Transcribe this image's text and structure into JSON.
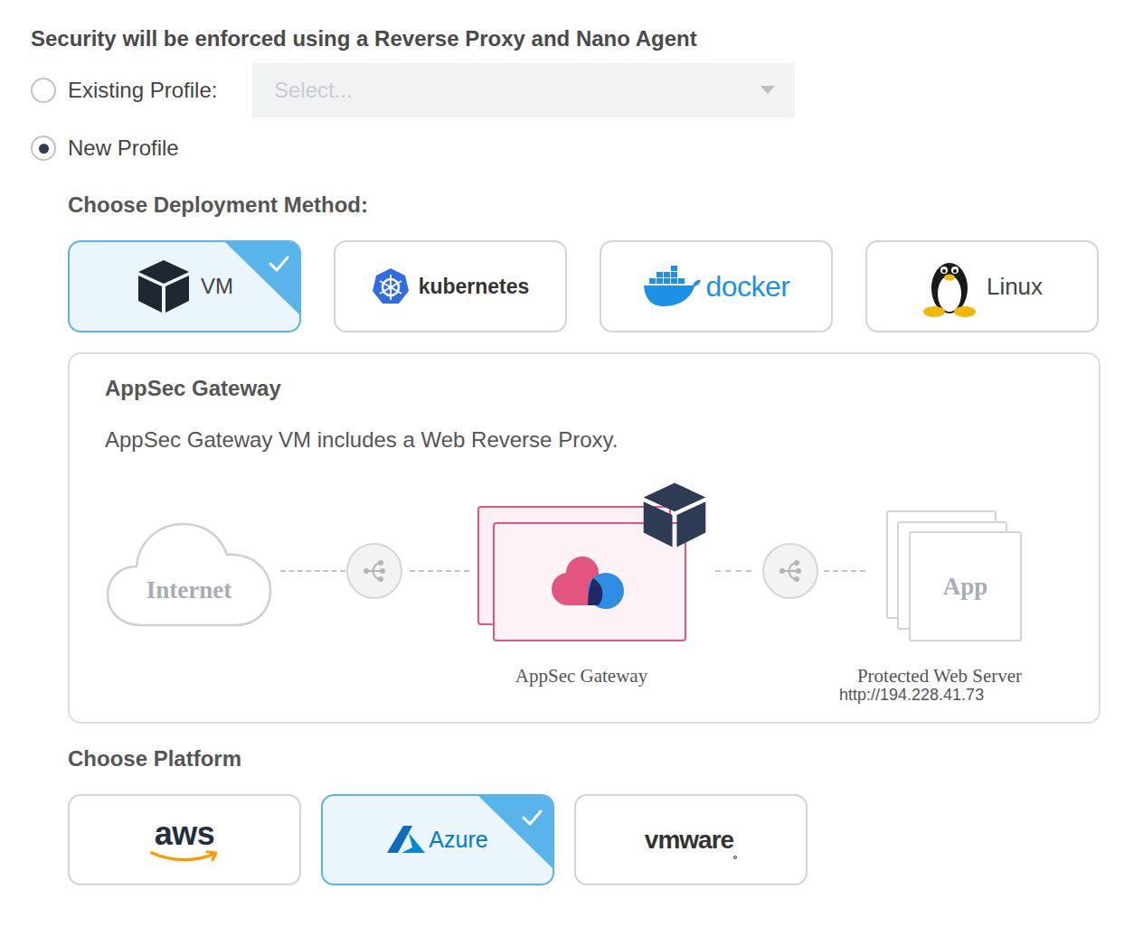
{
  "heading": "Security will be enforced using a Reverse Proxy and Nano Agent",
  "profile_options": [
    {
      "label": "Existing Profile:",
      "selected": false
    },
    {
      "label": "New Profile",
      "selected": true
    }
  ],
  "profile_select": {
    "placeholder": "Select..."
  },
  "deployment": {
    "label": "Choose Deployment Method:",
    "methods": [
      {
        "label": "VM",
        "selected": true,
        "kind": "vm"
      },
      {
        "label": "kubernetes",
        "selected": false,
        "kind": "kubernetes"
      },
      {
        "label": "docker",
        "selected": false,
        "kind": "docker"
      },
      {
        "label": "Linux",
        "selected": false,
        "kind": "linux"
      }
    ]
  },
  "diagram": {
    "title": "AppSec Gateway",
    "description": "AppSec Gateway VM includes a Web Reverse Proxy.",
    "internet": "Internet",
    "gateway_label": "AppSec Gateway",
    "app": "App",
    "server_label": "Protected Web Server",
    "server_url": "http://194.228.41.73"
  },
  "platform": {
    "label": "Choose Platform",
    "platforms": [
      {
        "label": "aws",
        "selected": false,
        "kind": "aws"
      },
      {
        "label": "Azure",
        "selected": true,
        "kind": "azure"
      },
      {
        "label": "vmware",
        "selected": false,
        "kind": "vmware"
      }
    ]
  }
}
